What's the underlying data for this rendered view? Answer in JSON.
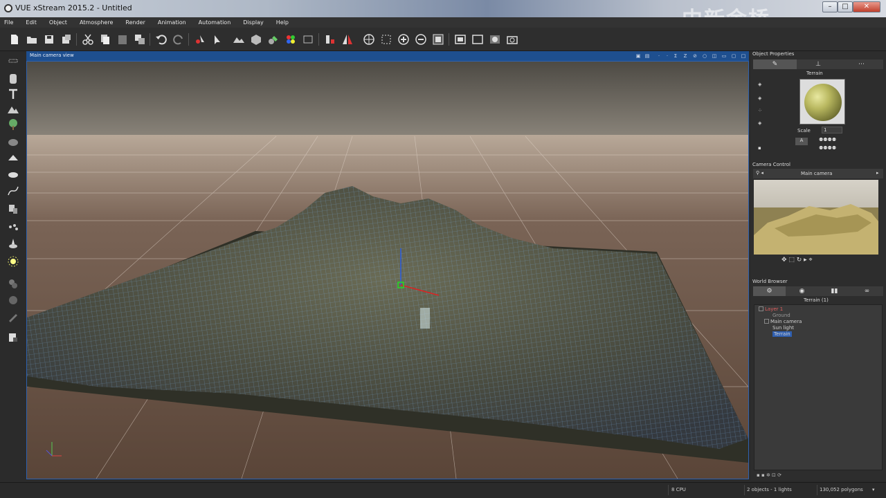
{
  "window": {
    "title": "VUE xStream 2015.2 - Untitled",
    "watermark": "中新金桥"
  },
  "menu": [
    "File",
    "Edit",
    "Object",
    "Atmosphere",
    "Render",
    "Animation",
    "Automation",
    "Display",
    "Help"
  ],
  "toolbar_icons": [
    "new-icon",
    "open-icon",
    "save-icon",
    "save-as-icon",
    "cut-icon",
    "copy-icon",
    "paste-icon",
    "duplicate-icon",
    "undo-icon",
    "redo-icon",
    "select-icon",
    "move-icon",
    "terrain-icon",
    "object-icon",
    "material-icon",
    "colors-icon",
    "align-icon",
    "split-icon",
    "mirror-icon",
    "globe-icon",
    "grid-icon",
    "zoom-in-icon",
    "zoom-out-icon",
    "frame-icon",
    "render-icon",
    "render-area-icon",
    "render-layers-icon",
    "camera-snapshot-icon"
  ],
  "left_tools": [
    "sphere-primitive-icon",
    "cylinder-icon",
    "text-icon",
    "terrain-tool-icon",
    "plant-icon",
    "rock-icon",
    "cloud-icon",
    "water-icon",
    "curve-icon",
    "replicate-icon",
    "explode-icon",
    "light-icon",
    "sun-icon",
    "metaball-icon",
    "hypertexture-icon",
    "brush-icon",
    "zoom-fit-icon"
  ],
  "viewport": {
    "title": "Main camera view"
  },
  "object_properties": {
    "title": "Object Properties",
    "object_name": "Terrain",
    "scale_label": "Scale",
    "scale_value": "1",
    "mode_label": "A"
  },
  "camera_control": {
    "title": "Camera Control",
    "camera_name": "Main camera"
  },
  "world_browser": {
    "title": "World Browser",
    "summary": "Terrain (1)",
    "items": [
      "Layer 1",
      "Ground",
      "Main camera",
      "Sun light",
      "Terrain"
    ],
    "selected": "Terrain"
  },
  "status": {
    "cpu": "8 CPU",
    "objects": "2 objects - 1 lights",
    "polygons": "130,052 polygons"
  },
  "colors": {
    "accent": "#1e4f8f",
    "selection": "#2e62b0",
    "ground": "#5a4538",
    "terrain_mesh": "#6aa9e8"
  }
}
